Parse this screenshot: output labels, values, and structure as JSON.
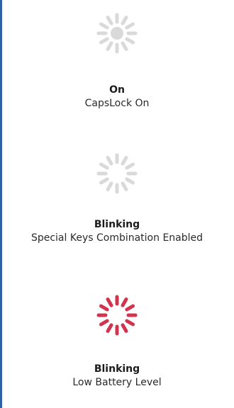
{
  "indicators": [
    {
      "state": "On",
      "description": "CapsLock On",
      "ray_color": "#d9d9d9",
      "center_dot": true,
      "center_color": "#d9d9d9"
    },
    {
      "state": "Blinking",
      "description": "Special Keys Combination Enabled",
      "ray_color": "#d9d9d9",
      "center_dot": false,
      "center_color": ""
    },
    {
      "state": "Blinking",
      "description": "Low Battery Level",
      "ray_color": "#d0344f",
      "center_dot": false,
      "center_color": ""
    }
  ]
}
